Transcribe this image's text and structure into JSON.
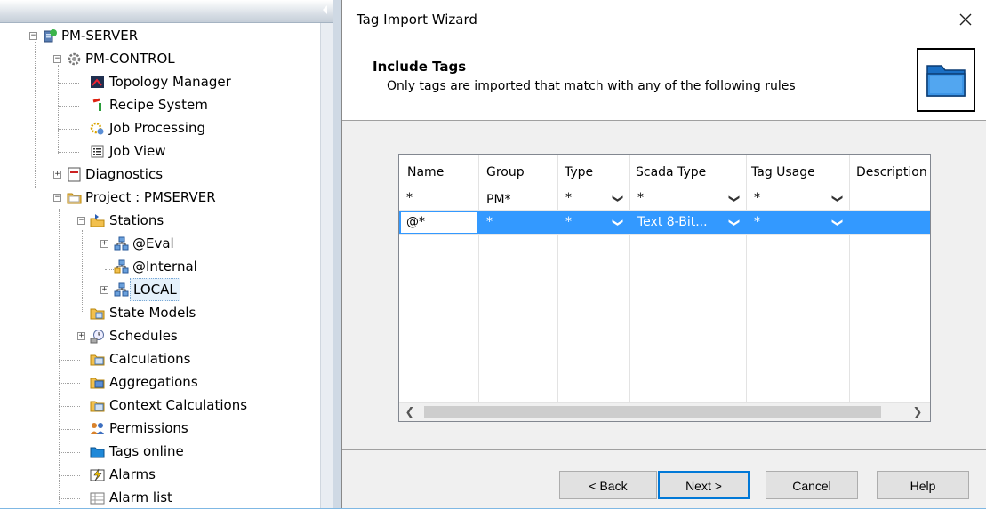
{
  "tree": {
    "items": [
      {
        "label": "PM-SERVER",
        "icon": "server-icon"
      },
      {
        "label": "PM-CONTROL",
        "icon": "gear-icon"
      },
      {
        "label": "Topology Manager",
        "icon": "topology-icon"
      },
      {
        "label": "Recipe System",
        "icon": "recipe-icon"
      },
      {
        "label": "Job Processing",
        "icon": "job-processing-icon"
      },
      {
        "label": "Job View",
        "icon": "list-icon"
      },
      {
        "label": "Diagnostics",
        "icon": "diagnostics-icon"
      },
      {
        "label": "Project : PMSERVER",
        "icon": "folder-icon"
      },
      {
        "label": "Stations",
        "icon": "stations-icon"
      },
      {
        "label": "@Eval",
        "icon": "network-icon"
      },
      {
        "label": "@Internal",
        "icon": "network-icon"
      },
      {
        "label": "LOCAL",
        "icon": "network-icon"
      },
      {
        "label": "State Models",
        "icon": "folder-icon"
      },
      {
        "label": "Schedules",
        "icon": "schedule-icon"
      },
      {
        "label": "Calculations",
        "icon": "folder-icon"
      },
      {
        "label": "Aggregations",
        "icon": "folder-icon"
      },
      {
        "label": "Context Calculations",
        "icon": "folder-icon"
      },
      {
        "label": "Permissions",
        "icon": "users-icon"
      },
      {
        "label": "Tags online",
        "icon": "tag-folder-icon"
      },
      {
        "label": "Alarms",
        "icon": "alarm-icon"
      },
      {
        "label": "Alarm list",
        "icon": "table-icon"
      }
    ]
  },
  "dialog": {
    "title": "Tag Import Wizard",
    "header_title": "Include Tags",
    "header_subtitle": "Only tags are imported that match with any of the following rules"
  },
  "grid": {
    "columns": [
      "Name",
      "Group",
      "Type",
      "Scada Type",
      "Tag Usage",
      "Description"
    ],
    "rows": [
      {
        "name": "*",
        "group": "PM*",
        "type": "*",
        "scada_type": "*",
        "tag_usage": "*",
        "description": ""
      },
      {
        "name": "@*",
        "group": "*",
        "type": "*",
        "scada_type": "Text 8-Bit...",
        "tag_usage": "*",
        "description": ""
      }
    ],
    "dropdown_glyph": "❯",
    "scroll_left": "❮",
    "scroll_right": "❯"
  },
  "buttons": {
    "back": "< Back",
    "next": "Next >",
    "cancel": "Cancel",
    "help": "Help"
  },
  "colors": {
    "selection": "#3399ff",
    "background": "#7fb8e4"
  }
}
